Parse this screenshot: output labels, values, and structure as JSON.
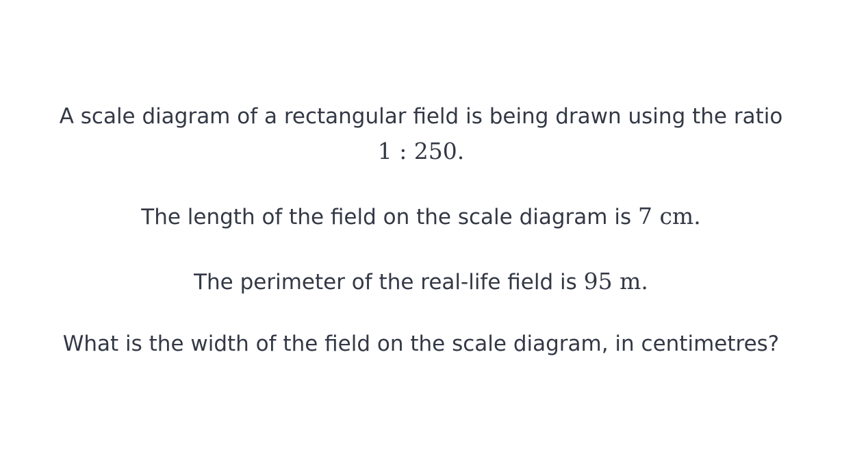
{
  "question": {
    "line1": "A scale diagram of a rectangular field is being drawn using the ratio",
    "ratio": "1 : 250.",
    "length_text": "The length of the field on the scale diagram is",
    "length_value": "7 cm.",
    "perimeter_text": "The perimeter of the real-life field is",
    "perimeter_value": "95 m.",
    "prompt": "What is the width of the field on the scale diagram, in centimetres?"
  }
}
